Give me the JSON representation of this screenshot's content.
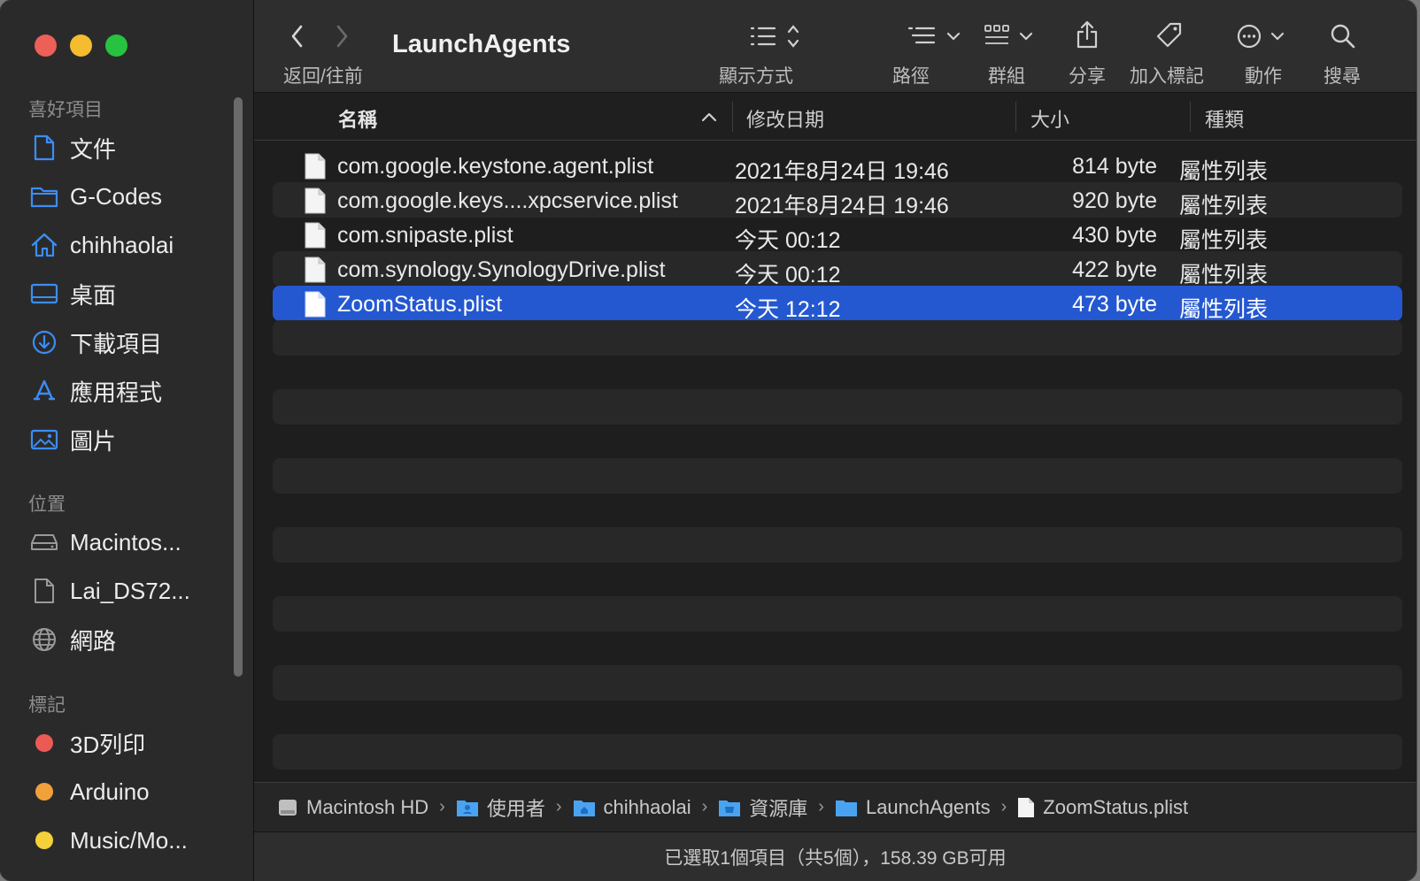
{
  "window_title": "LaunchAgents",
  "toolbar": {
    "nav_label": "返回/往前",
    "view_label": "顯示方式",
    "path_label": "路徑",
    "group_label": "群組",
    "share_label": "分享",
    "tag_label": "加入標記",
    "action_label": "動作",
    "search_label": "搜尋"
  },
  "sidebar": {
    "favorites_header": "喜好項目",
    "favorites": [
      {
        "label": "文件",
        "icon": "document-icon"
      },
      {
        "label": "G-Codes",
        "icon": "folder-icon"
      },
      {
        "label": "chihhaolai",
        "icon": "home-icon"
      },
      {
        "label": "桌面",
        "icon": "desktop-icon"
      },
      {
        "label": "下載項目",
        "icon": "download-icon"
      },
      {
        "label": "應用程式",
        "icon": "applications-icon"
      },
      {
        "label": "圖片",
        "icon": "pictures-icon"
      }
    ],
    "locations_header": "位置",
    "locations": [
      {
        "label": "Macintos...",
        "icon": "drive-icon"
      },
      {
        "label": "Lai_DS72...",
        "icon": "server-icon"
      },
      {
        "label": "網路",
        "icon": "network-icon"
      }
    ],
    "tags_header": "標記",
    "tags": [
      {
        "label": "3D列印",
        "color": "#ec5a55"
      },
      {
        "label": "Arduino",
        "color": "#f0a13a"
      },
      {
        "label": "Music/Mo...",
        "color": "#f4d03a"
      }
    ]
  },
  "columns": {
    "name": "名稱",
    "date": "修改日期",
    "size": "大小",
    "kind": "種類"
  },
  "files": [
    {
      "name": "com.google.keystone.agent.plist",
      "date": "2021年8月24日 19:46",
      "size": "814 byte",
      "kind": "屬性列表"
    },
    {
      "name": "com.google.keys....xpcservice.plist",
      "date": "2021年8月24日 19:46",
      "size": "920 byte",
      "kind": "屬性列表"
    },
    {
      "name": "com.snipaste.plist",
      "date": "今天 00:12",
      "size": "430 byte",
      "kind": "屬性列表"
    },
    {
      "name": "com.synology.SynologyDrive.plist",
      "date": "今天 00:12",
      "size": "422 byte",
      "kind": "屬性列表"
    },
    {
      "name": "ZoomStatus.plist",
      "date": "今天 12:12",
      "size": "473 byte",
      "kind": "屬性列表",
      "selected": true
    }
  ],
  "path": [
    {
      "label": "Macintosh HD",
      "icon": "drive-icon"
    },
    {
      "label": "使用者",
      "icon": "users-folder-icon"
    },
    {
      "label": "chihhaolai",
      "icon": "home-folder-icon"
    },
    {
      "label": "資源庫",
      "icon": "library-folder-icon"
    },
    {
      "label": "LaunchAgents",
      "icon": "folder-icon"
    },
    {
      "label": "ZoomStatus.plist",
      "icon": "file-icon"
    }
  ],
  "status": "已選取1個項目（共5個），158.39 GB可用",
  "colors": {
    "selection": "#2458d0",
    "accent_icon": "#3a8ef6"
  }
}
